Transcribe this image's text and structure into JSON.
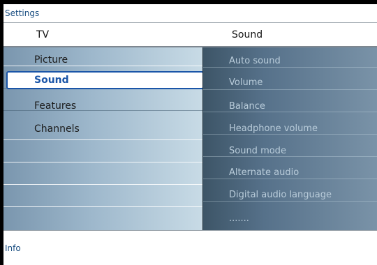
{
  "window": {
    "title": "Settings"
  },
  "header": {
    "left": "TV",
    "right": "Sound"
  },
  "menu": {
    "items": [
      "Picture",
      "Sound",
      "Features",
      "Channels"
    ],
    "selected": "Sound"
  },
  "submenu": {
    "items": [
      "Auto sound",
      "Volume",
      "Balance",
      "Headphone volume",
      "Sound mode",
      "Alternate audio",
      "Digital audio language",
      "......."
    ]
  },
  "footer": {
    "info": "Info"
  }
}
